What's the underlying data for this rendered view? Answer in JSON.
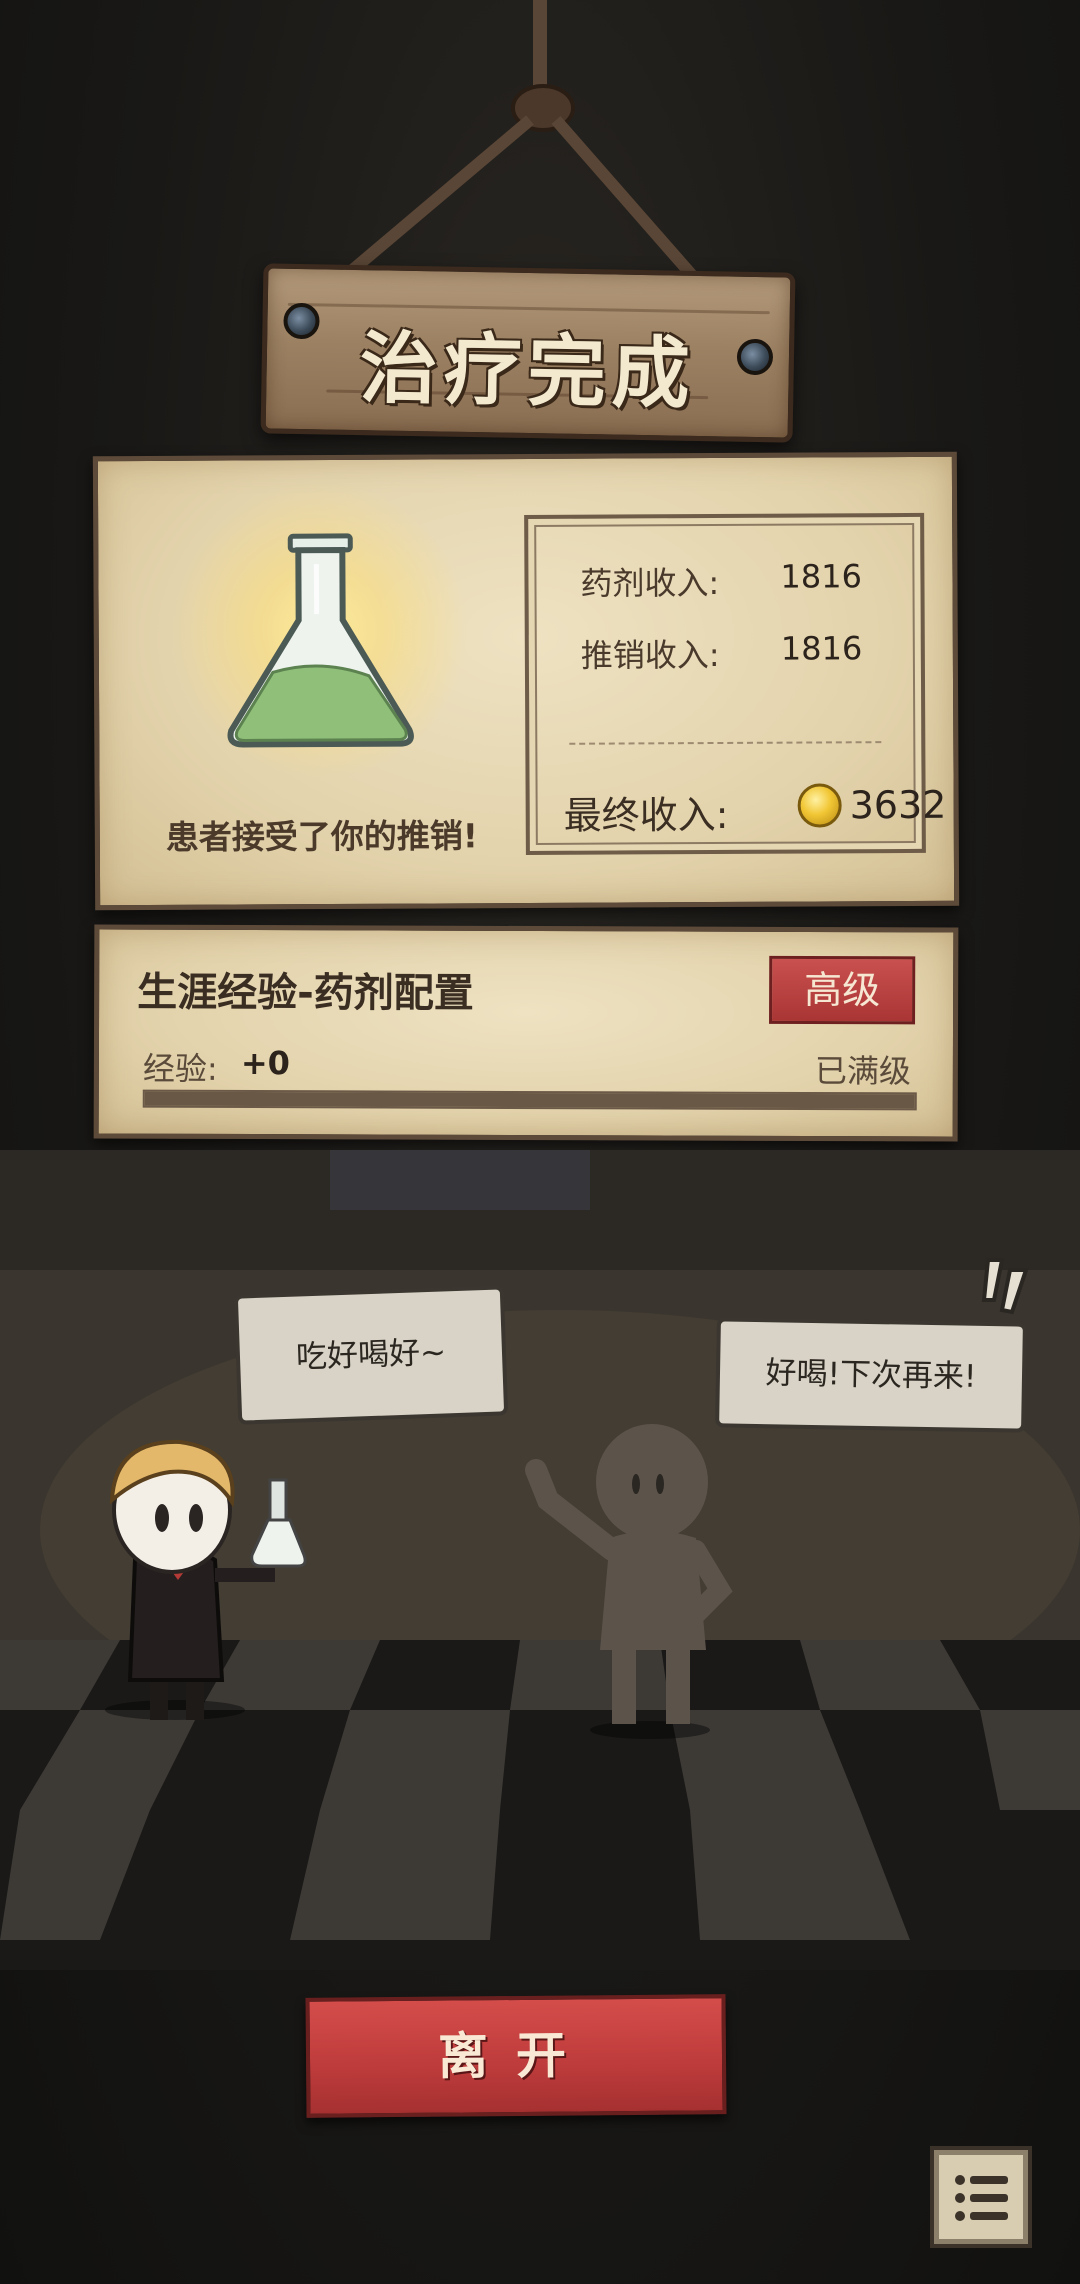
{
  "header": {
    "title": "治疗完成"
  },
  "result": {
    "message": "患者接受了你的推销!",
    "potion_income_label": "药剂收入:",
    "potion_income_value": "1816",
    "promo_income_label": "推销收入:",
    "promo_income_value": "1816",
    "final_income_label": "最终收入:",
    "final_income_value": "3632"
  },
  "experience": {
    "title": "生涯经验-药剂配置",
    "level_badge": "高级",
    "exp_label": "经验:",
    "exp_value": "+0",
    "status": "已满级",
    "progress": 1.0
  },
  "dialogue": {
    "doctor": "吃好喝好~",
    "patient": "好喝!下次再来!"
  },
  "actions": {
    "leave_label": "离开"
  },
  "icons": {
    "flask": "flask-icon",
    "coin": "gold-coin-icon",
    "menu": "list-menu-icon"
  },
  "colors": {
    "button_red": "#c0403f",
    "parchment": "#e6d7b3",
    "potion_green": "#8fbf78",
    "coin_gold": "#f1c634"
  }
}
